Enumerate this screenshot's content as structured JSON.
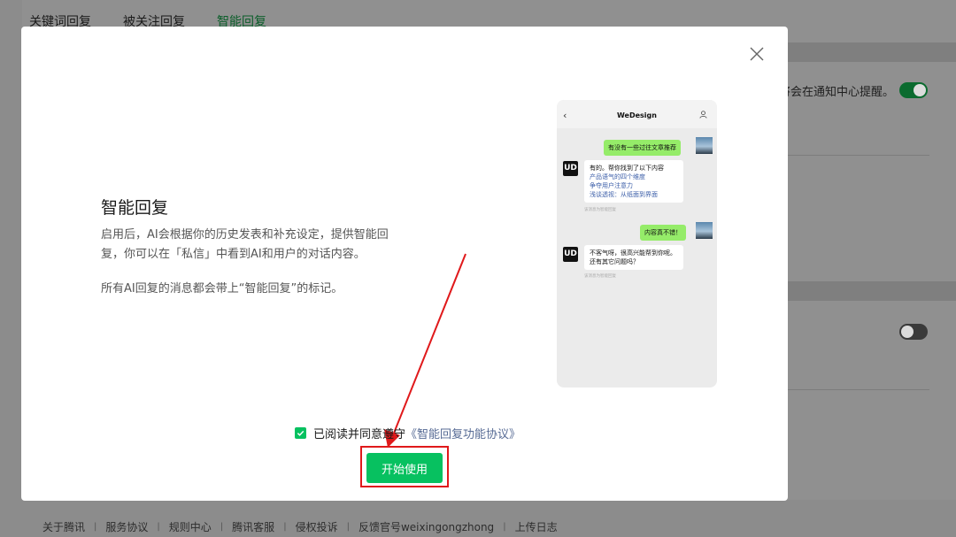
{
  "background": {
    "tabs": [
      "关键词回复",
      "被关注回复",
      "智能回复"
    ],
    "note": "将会在通知中心提醒。",
    "footer_links": [
      "关于腾讯",
      "服务协议",
      "规则中心",
      "腾讯客服",
      "侵权投诉",
      "反馈官号weixingongzhong",
      "上传日志"
    ]
  },
  "modal": {
    "close_icon": "close-icon",
    "title": "智能回复",
    "description": "启用后，AI会根据你的历史发表和补充设定，提供智能回复，你可以在「私信」中看到AI和用户的对话内容。",
    "description2": "所有AI回复的消息都会带上“智能回复”的标记。",
    "phone": {
      "title": "WeDesign",
      "msg1": "有没有一些过往文章推荐",
      "reply1_line1": "有的。帮你找到了以下内容",
      "reply1_links": [
        "产品语气的四个维度",
        "争夺用户注意力",
        "浅谈透视：从纸面到界面"
      ],
      "msg2": "内容真不错！",
      "reply2": "不客气呀，很高兴能帮到你呢。还有其它问题吗？",
      "ai_note": "该消息为智能回复"
    },
    "agree_text": "已阅读并同意遵守",
    "agree_link": "《智能回复功能协议》",
    "start_button": "开始使用"
  },
  "colors": {
    "accent_green": "#07c160",
    "link_blue": "#576b95",
    "highlight_red": "#e0191b"
  }
}
